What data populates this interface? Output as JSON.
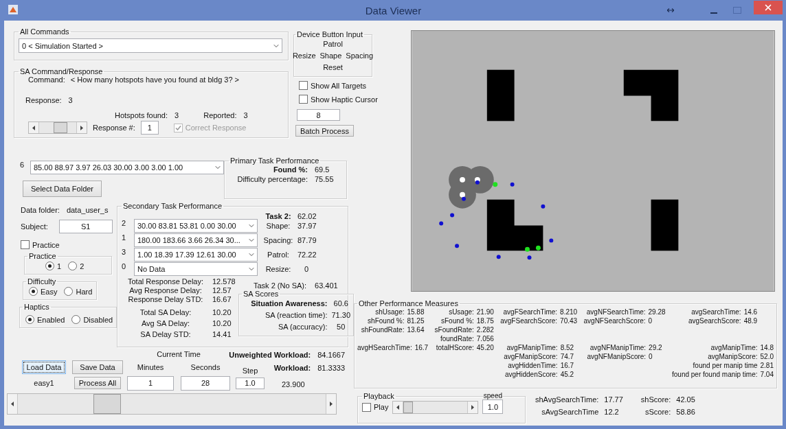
{
  "window": {
    "title": "Data Viewer"
  },
  "all_commands": {
    "title": "All Commands",
    "value": "0 < Simulation Started >"
  },
  "sa_panel": {
    "title": "SA Command/Response",
    "command_label": "Command:",
    "command": "< How many hotspots have you found at bldg 3? >",
    "response_label": "Response:",
    "response": "3",
    "hotspots_label": "Hotspots found:",
    "hotspots": "3",
    "reported_label": "Reported:",
    "reported": "3",
    "slider": {
      "level": 0.62
    },
    "response_num_label": "Response #:",
    "response_num": "1",
    "correct": {
      "label": "Correct Response",
      "checked": true,
      "disabled": true
    }
  },
  "device_panel": {
    "title": "Device Button Input",
    "rows": [
      [
        "Patrol"
      ],
      [
        "Resize",
        "Shape",
        "Spacing"
      ],
      [
        "Reset"
      ]
    ]
  },
  "toggles": [
    {
      "label": "Show All Targets",
      "checked": false
    },
    {
      "label": "Show Haptic Cursor",
      "checked": false
    }
  ],
  "batch": {
    "value": "8",
    "button": "Batch Process"
  },
  "values_row": {
    "index": "6",
    "value": "85.00  88.97  3.97  26.03  30.00  3.00  3.00  1.00"
  },
  "select_folder_button": "Select Data Folder",
  "primary_panel": {
    "title": "Primary Task Performance",
    "rows": [
      {
        "label": "Found %:",
        "value": "69.5",
        "bold": true
      },
      {
        "label": "Difficulty percentage:",
        "value": "75.55",
        "bold": false
      }
    ]
  },
  "data_folder": {
    "label": "Data folder:",
    "value": "data_user_s"
  },
  "subject": {
    "label": "Subject:",
    "value": "S1"
  },
  "practice_checkbox": {
    "label": "Practice",
    "checked": false
  },
  "radio_groups": [
    {
      "title": "Practice",
      "options": [
        {
          "label": "1",
          "selected": true
        },
        {
          "label": "2",
          "selected": false
        }
      ]
    },
    {
      "title": "Difficulty",
      "options": [
        {
          "label": "Easy",
          "selected": true
        },
        {
          "label": "Hard",
          "selected": false
        }
      ]
    },
    {
      "title": "Haptics",
      "options": [
        {
          "label": "Enabled",
          "selected": true
        },
        {
          "label": "Disabled",
          "selected": false
        }
      ]
    }
  ],
  "secondary_panel": {
    "title": "Secondary Task Performance",
    "task2": {
      "label": "Task 2:",
      "value": "62.02"
    },
    "tasks": [
      {
        "index": "2",
        "value": "30.00  83.81  53.81  0.00  30.00",
        "label": "Shape:",
        "score": "37.97"
      },
      {
        "index": "1",
        "value": "180.00  183.66  3.66  26.34  30...",
        "label": "Spacing:",
        "score": "87.79"
      },
      {
        "index": "3",
        "value": "1.00  18.39  17.39  12.61  30.00",
        "label": "Patrol:",
        "score": "72.22"
      },
      {
        "index": "0",
        "value": "No Data",
        "label": "Resize:",
        "score": "0"
      }
    ],
    "delays": [
      {
        "label": "Total Response Delay:",
        "value": "12.578"
      },
      {
        "label": "Avg Response Delay:",
        "value": "12.57"
      },
      {
        "label": "Response Delay STD:",
        "value": "16.67"
      },
      {
        "label": "Total SA Delay:",
        "value": "10.20"
      },
      {
        "label": "Avg SA Delay:",
        "value": "10.20"
      },
      {
        "label": "SA Delay STD:",
        "value": "14.41"
      }
    ],
    "task2_nosa": {
      "label": "Task 2 (No SA):",
      "value": "63.401"
    },
    "sa_scores": {
      "title": "SA Scores",
      "rows": [
        {
          "label": "Situation Awareness:",
          "value": "60.6",
          "bold": true
        },
        {
          "label": "SA (reaction time):",
          "value": "71.30",
          "bold": false
        },
        {
          "label": "SA (accuracy):",
          "value": "50",
          "bold": false
        }
      ]
    }
  },
  "workload": [
    {
      "label": "Unweighted Workload:",
      "value": "84.1667"
    },
    {
      "label": "Workload:",
      "value": "81.3333"
    }
  ],
  "load_button": {
    "label": "Load Data",
    "focused": true
  },
  "save_button": "Save Data",
  "file_name": "easy1",
  "process_button": "Process All",
  "current_time": {
    "title": "Current Time",
    "minutes_label": "Minutes",
    "minutes": "1",
    "seconds_label": "Seconds",
    "seconds": "28"
  },
  "step": {
    "label": "Step",
    "value": "1.0"
  },
  "elapsed": "23.900",
  "timeline": {
    "level": 0.27
  },
  "measures": {
    "title": "Other Performance Measures",
    "columns": [
      [
        [
          {
            "label": "shUsage:",
            "value": "15.88"
          },
          {
            "label": "shFound %:",
            "value": "81.25"
          },
          {
            "label": "shFoundRate:",
            "value": "13.64"
          }
        ],
        [
          {
            "label": "avgHSearchTime:",
            "value": "16.7"
          }
        ]
      ],
      [
        [
          {
            "label": "sUsage:",
            "value": "21.90"
          },
          {
            "label": "sFound %:",
            "value": "18.75"
          },
          {
            "label": "sFoundRate:",
            "value": "2.282"
          },
          {
            "label": "foundRate:",
            "value": "7.056"
          },
          {
            "label": "totalHScore:",
            "value": "45.20"
          }
        ]
      ],
      [
        [
          {
            "label": "avgFSearchTime:",
            "value": "8.210"
          },
          {
            "label": "avgFSearchScore:",
            "value": "70.43"
          }
        ],
        [
          {
            "label": "avgFManipTime:",
            "value": "8.52"
          },
          {
            "label": "avgFManipScore:",
            "value": "74.7"
          },
          {
            "label": "avgHiddenTime:",
            "value": "16.7"
          },
          {
            "label": "avgHiddenScore:",
            "value": "45.2"
          }
        ]
      ],
      [
        [
          {
            "label": "avgNFSearchTime:",
            "value": "29.28"
          },
          {
            "label": "avgNFSearchScore:",
            "value": "0"
          }
        ],
        [
          {
            "label": "avgNFManipTime:",
            "value": "29.2"
          },
          {
            "label": "avgNFManipScore:",
            "value": "0"
          }
        ]
      ],
      [
        [
          {
            "label": "avgSearchTime:",
            "value": "14.6"
          },
          {
            "label": "avgSearchScore:",
            "value": "48.9"
          }
        ],
        [
          {
            "label": "avgManipTime:",
            "value": "14.8"
          },
          {
            "label": "avgManipScore:",
            "value": "52.0"
          },
          {
            "label": "found per manip time",
            "value": "2.81"
          },
          {
            "label": "found per found manip time:",
            "value": "7.04"
          }
        ]
      ]
    ]
  },
  "playback": {
    "title": "Playback",
    "play": {
      "label": "Play",
      "checked": false
    },
    "slider": {
      "level": 0
    },
    "speed_label": "speed",
    "speed": "1.0"
  },
  "summary": [
    [
      {
        "label": "shAvgSearchTime:",
        "value": "17.77"
      },
      {
        "label": "sAvgSearchTime",
        "value": "12.2"
      }
    ],
    [
      {
        "label": "shScore:",
        "value": "42.05"
      },
      {
        "label": "sScore:",
        "value": "58.86"
      }
    ]
  ]
}
